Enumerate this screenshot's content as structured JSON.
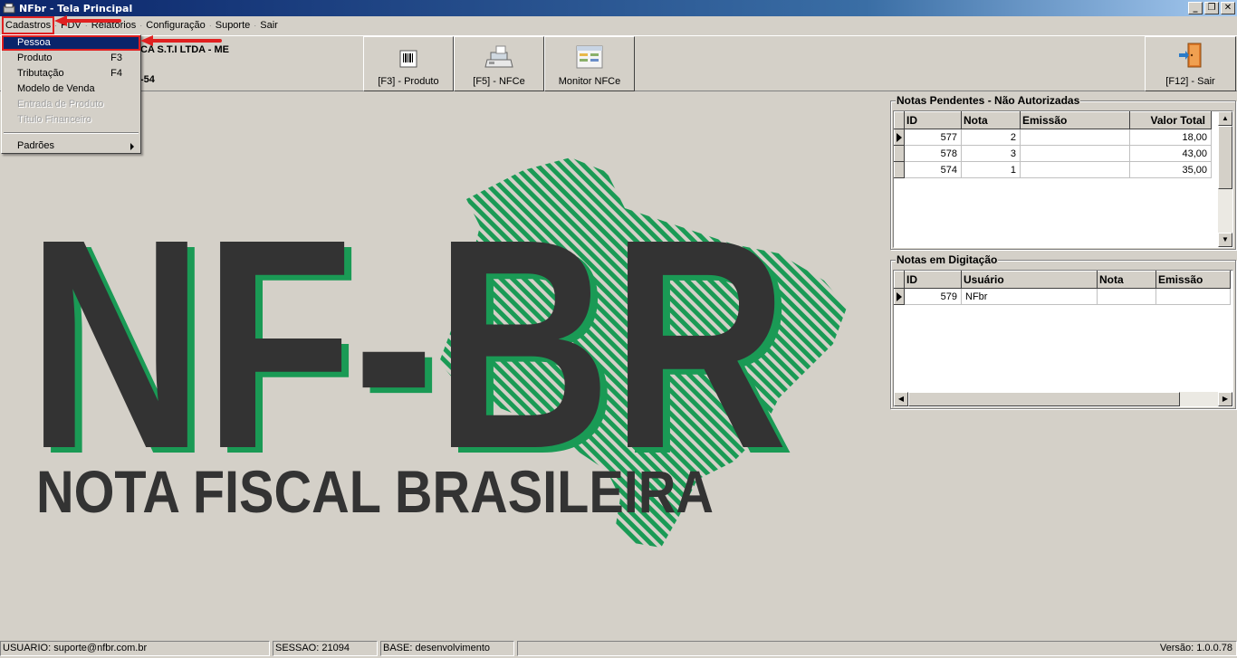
{
  "window": {
    "title": "NFbr - Tela Principal",
    "minimize": "_",
    "restore": "❐",
    "close": "✕"
  },
  "menubar": {
    "items": [
      "Cadastros",
      "PDV",
      "Relatórios",
      "Configuração",
      "Suporte",
      "Sair"
    ],
    "separator": "·"
  },
  "dropdown": {
    "items": [
      {
        "label": "Pessoa",
        "shortcut": "",
        "state": "selected"
      },
      {
        "label": "Produto",
        "shortcut": "F3",
        "state": "enabled"
      },
      {
        "label": "Tributação",
        "shortcut": "F4",
        "state": "enabled"
      },
      {
        "label": "Modelo de Venda",
        "shortcut": "",
        "state": "enabled"
      },
      {
        "label": "Entrada de Produto",
        "shortcut": "",
        "state": "disabled"
      },
      {
        "label": "Título Financeiro",
        "shortcut": "",
        "state": "disabled"
      }
    ],
    "submenu_label": "Padrões"
  },
  "company": {
    "name_fragment": "CA S.T.I LTDA - ME",
    "id_fragment": "-54"
  },
  "toolbar": {
    "produto_label": "[F3] - Produto",
    "nfce_label": "[F5] - NFCe",
    "monitor_label": "Monitor NFCe",
    "sair_label": "[F12] - Sair"
  },
  "logo": {
    "main": "NF-BR",
    "tagline": "NOTA FISCAL BRASILEIRA"
  },
  "pendentes": {
    "title": "Notas Pendentes - Não Autorizadas",
    "columns": [
      "ID",
      "Nota",
      "Emissão",
      "Valor Total"
    ],
    "rows": [
      {
        "id": "577",
        "nota": "2",
        "emissao": "",
        "valor": "18,00"
      },
      {
        "id": "578",
        "nota": "3",
        "emissao": "",
        "valor": "43,00"
      },
      {
        "id": "574",
        "nota": "1",
        "emissao": "",
        "valor": "35,00"
      }
    ]
  },
  "digitacao": {
    "title": "Notas em Digitação",
    "columns": [
      "ID",
      "Usuário",
      "Nota",
      "Emissão"
    ],
    "rows": [
      {
        "id": "579",
        "usuario": "NFbr",
        "nota": "",
        "emissao": ""
      }
    ]
  },
  "status": {
    "usuario": "USUARIO: suporte@nfbr.com.br",
    "sessao": "SESSAO: 21094",
    "base": "BASE: desenvolvimento",
    "versao": "Versão: 1.0.0.78"
  },
  "colors": {
    "accent_green": "#1a9a55",
    "logo_dark": "#333333",
    "menu_highlight": "#0a246a",
    "annotation_red": "#e02020"
  }
}
